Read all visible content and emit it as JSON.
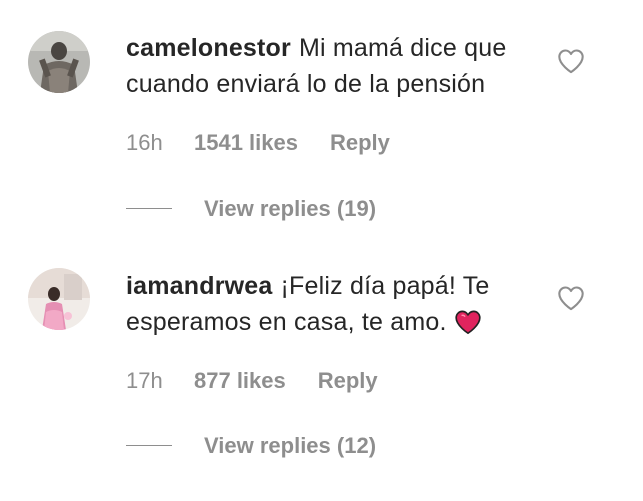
{
  "comments": [
    {
      "username": "camelonestor",
      "text": "Mi mamá dice que cuando enviará lo de la pensión",
      "time": "16h",
      "likes": "1541 likes",
      "reply_label": "Reply",
      "view_replies": "View replies (19)",
      "like_icon": "heart-outline-icon"
    },
    {
      "username": "iamandrwea",
      "text": "¡Feliz día papá! Te esperamos en casa, te amo.",
      "emoji": "red-heart-emoji",
      "time": "17h",
      "likes": "877 likes",
      "reply_label": "Reply",
      "view_replies": "View replies (12)",
      "like_icon": "heart-outline-icon"
    }
  ],
  "colors": {
    "text": "#262626",
    "secondary": "#8e8e8e",
    "heart_emoji": "#e0245e"
  }
}
